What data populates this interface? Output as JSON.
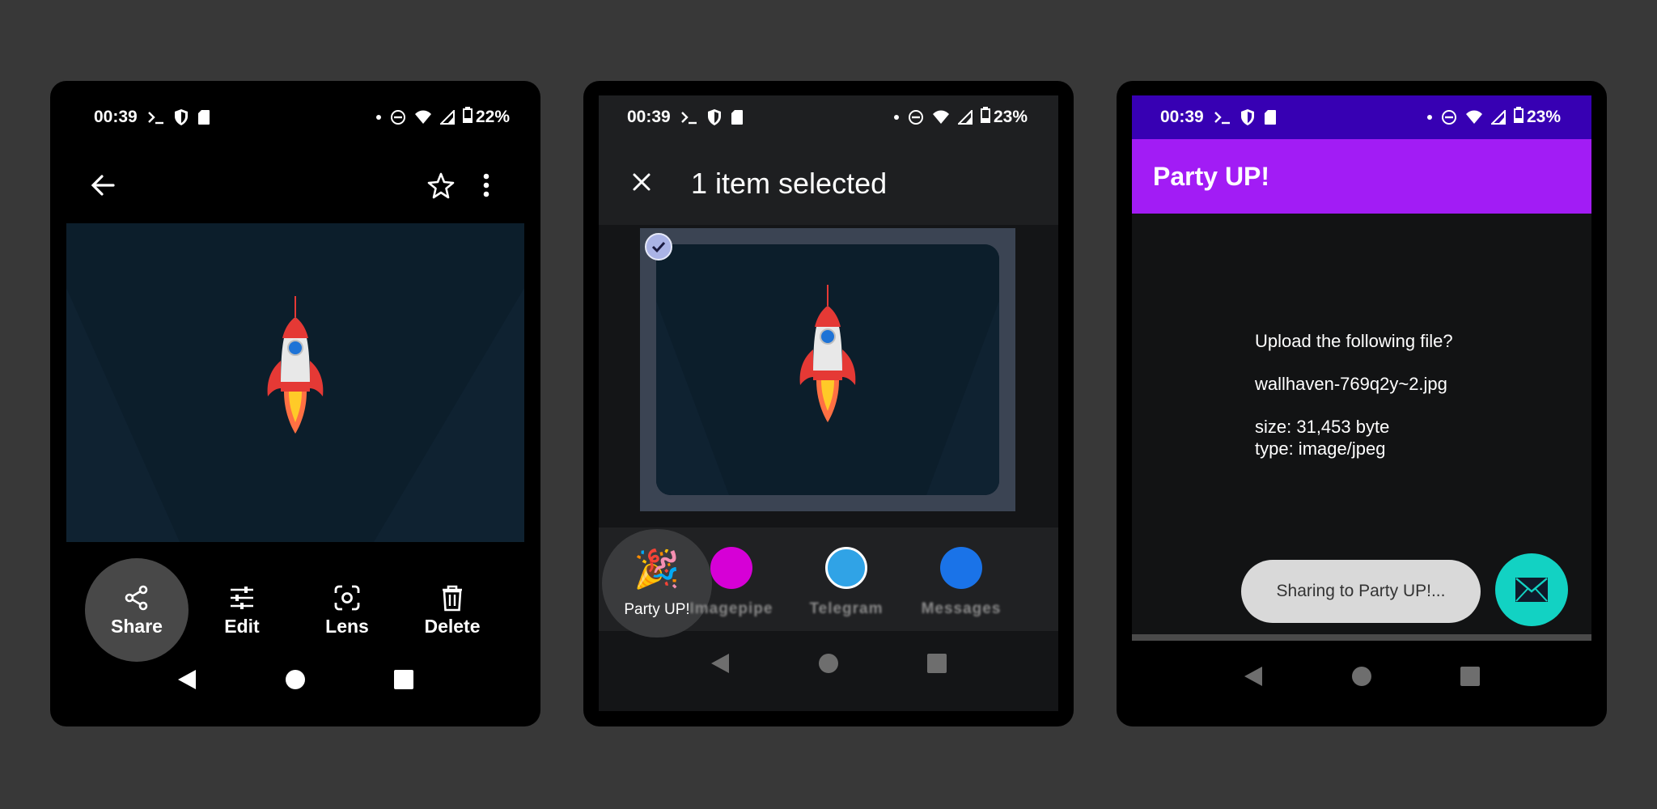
{
  "status_bars": [
    {
      "time": "00:39",
      "battery": "22%"
    },
    {
      "time": "00:39",
      "battery": "23%"
    },
    {
      "time": "00:39",
      "battery": "23%"
    }
  ],
  "photo_viewer": {
    "actions": [
      {
        "label": "Share",
        "icon": "share-icon"
      },
      {
        "label": "Edit",
        "icon": "tune-icon"
      },
      {
        "label": "Lens",
        "icon": "lens-icon"
      },
      {
        "label": "Delete",
        "icon": "trash-icon"
      }
    ]
  },
  "share_sheet": {
    "title": "1 item selected",
    "targets": [
      {
        "label": "Party UP!",
        "icon": "party-popper-icon",
        "color": ""
      },
      {
        "label": "Imagepipe",
        "icon": "app-icon",
        "color": "#d600d6"
      },
      {
        "label": "Telegram",
        "icon": "app-icon",
        "color": "#30a3e6"
      },
      {
        "label": "Messages",
        "icon": "app-icon",
        "color": "#1a73e8"
      }
    ]
  },
  "party_up": {
    "app_title": "Party UP!",
    "prompt": "Upload the following file?",
    "filename": "wallhaven-769q2y~2.jpg",
    "size": "size: 31,453 byte",
    "type": "type: image/jpeg",
    "toast": "Sharing to Party UP!...",
    "status_color": "#3700b3",
    "appbar_color": "#a21cf5",
    "fab_color": "#12d2c3"
  }
}
